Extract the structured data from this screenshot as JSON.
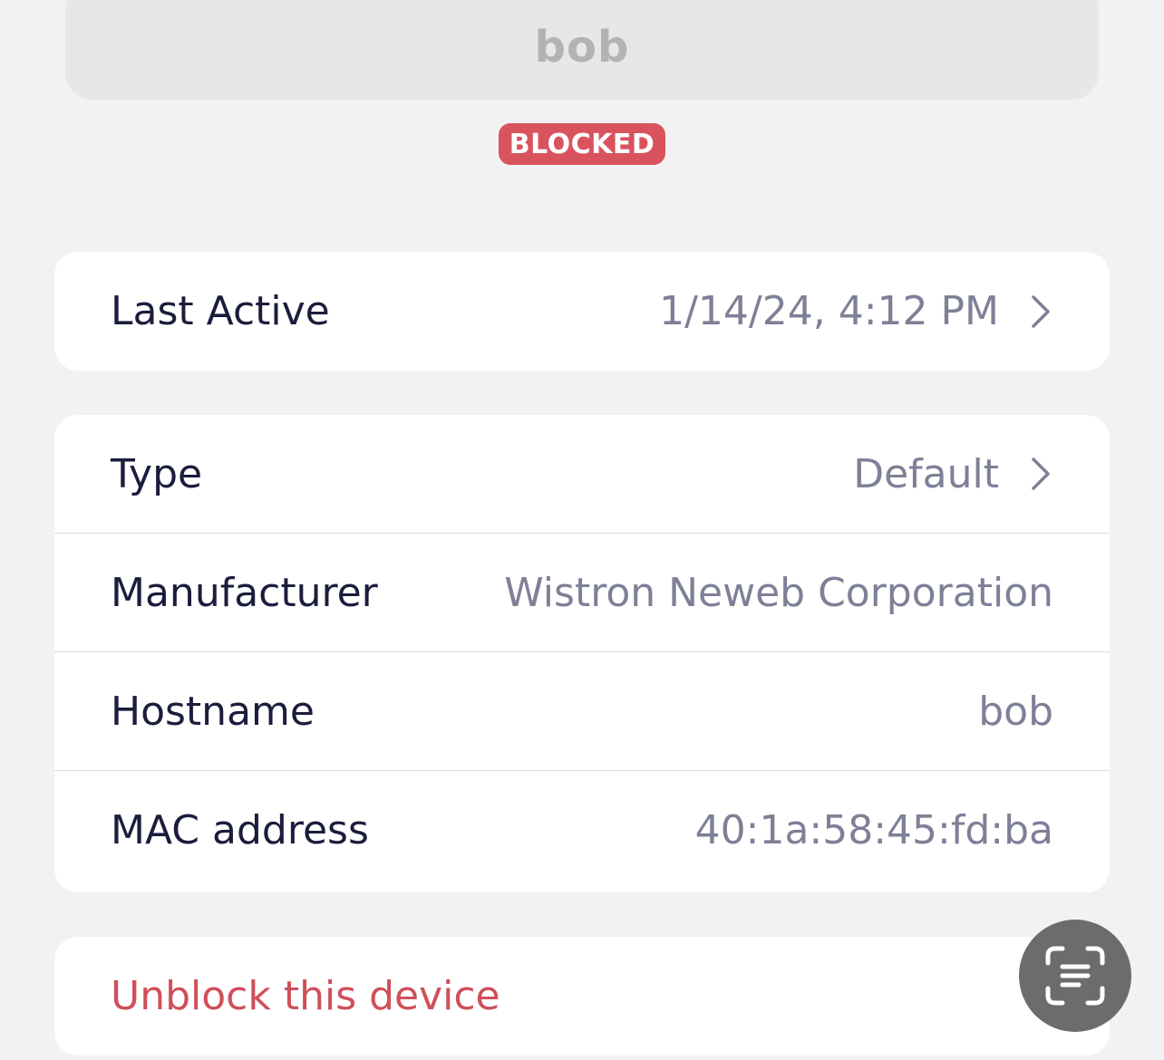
{
  "device": {
    "name": "bob",
    "status_badge": "BLOCKED"
  },
  "activity_card": {
    "last_active": {
      "label": "Last Active",
      "value": "1/14/24, 4:12 PM"
    }
  },
  "details_card": {
    "type": {
      "label": "Type",
      "value": "Default"
    },
    "manufacturer": {
      "label": "Manufacturer",
      "value": "Wistron Neweb Corporation"
    },
    "hostname": {
      "label": "Hostname",
      "value": "bob"
    },
    "mac_address": {
      "label": "MAC address",
      "value": "40:1a:58:45:fd:ba"
    }
  },
  "actions_card": {
    "unblock_label": "Unblock this device"
  },
  "overlay": {
    "fab_icon": "live-text-scan-icon"
  },
  "colors": {
    "background": "#f2f2f3",
    "badge": "#d9535e",
    "label_text": "#1b1d3c",
    "value_text": "#7e8097",
    "destructive": "#cf4f5a"
  }
}
